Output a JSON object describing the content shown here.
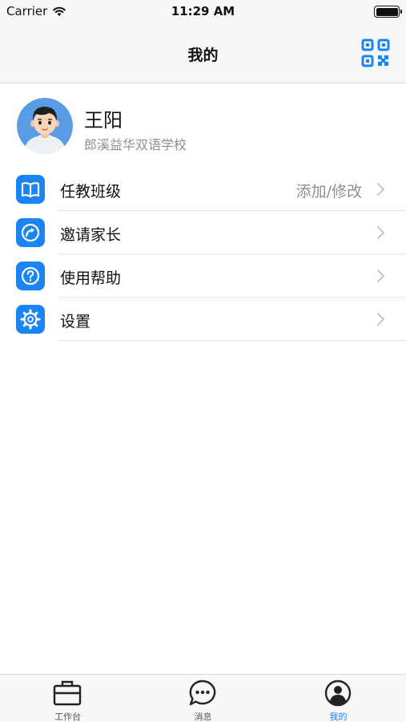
{
  "status_bar": {
    "carrier": "Carrier",
    "time": "11:29 AM"
  },
  "nav": {
    "title": "我的",
    "qr_icon": "qr-code-icon"
  },
  "profile": {
    "name": "王阳",
    "school": "郎溪益华双语学校",
    "avatar": "avatar-boy"
  },
  "menu": {
    "items": [
      {
        "label": "任教班级",
        "detail": "添加/修改",
        "icon": "book-icon"
      },
      {
        "label": "邀请家长",
        "detail": "",
        "icon": "share-icon"
      },
      {
        "label": "使用帮助",
        "detail": "",
        "icon": "help-icon"
      },
      {
        "label": "设置",
        "detail": "",
        "icon": "gear-icon"
      }
    ]
  },
  "tabs": [
    {
      "label": "工作台",
      "icon": "briefcase-icon",
      "active": false
    },
    {
      "label": "消息",
      "icon": "chat-bubble-icon",
      "active": false
    },
    {
      "label": "我的",
      "icon": "person-icon",
      "active": true
    }
  ],
  "colors": {
    "accent": "#1a84f2",
    "secondary_text": "#8e8e93",
    "bar_bg": "#f7f7f7"
  }
}
